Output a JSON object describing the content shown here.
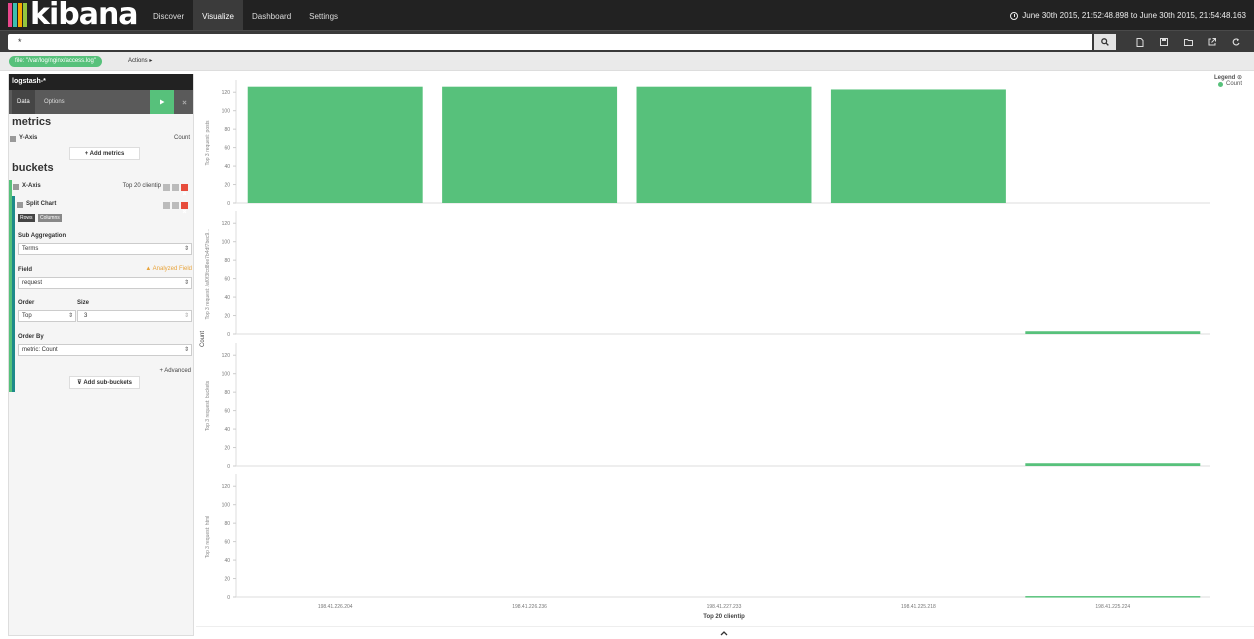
{
  "app": {
    "logo_text": "kibana",
    "logo_colors": [
      "#e8478b",
      "#3ebeb0",
      "#f5a700",
      "#94c63d"
    ],
    "nav": [
      "Discover",
      "Visualize",
      "Dashboard",
      "Settings"
    ],
    "active_nav": "Visualize",
    "time_range": "June 30th 2015, 21:52:48.898 to June 30th 2015, 21:54:48.163"
  },
  "search": {
    "query": "*",
    "toolbar_icons": [
      "new-icon",
      "save-icon",
      "open-icon",
      "share-icon",
      "refresh-icon"
    ]
  },
  "filter": {
    "pill": "file: \"/var/log/nginx/access.log\"",
    "actions": "Actions ▸"
  },
  "sidebar": {
    "index_pattern": "logstash-*",
    "tabs": [
      "Data",
      "Options"
    ],
    "metrics_heading": "metrics",
    "yaxis_label": "Y-Axis",
    "yaxis_value": "Count",
    "add_metrics": "+ Add metrics",
    "buckets_heading": "buckets",
    "xaxis_label": "X-Axis",
    "xaxis_value": "Top 20 clientip",
    "split_label": "Split Chart",
    "rows_label": "Rows",
    "columns_label": "Columns",
    "sub_agg_label": "Sub Aggregation",
    "sub_agg_value": "Terms",
    "field_label": "Field",
    "analyzed_warning": "Analyzed Field",
    "field_value": "request",
    "order_label": "Order",
    "size_label": "Size",
    "order_value": "Top",
    "size_value": "3",
    "order_by_label": "Order By",
    "order_by_value": "metric: Count",
    "advanced": "+ Advanced",
    "add_sub_buckets": "Add sub-buckets",
    "accent_green": "#57c17b",
    "accent_teal": "#1e8a8a"
  },
  "chart": {
    "legend_title": "Legend",
    "legend_item": "Count",
    "ylabel": "Count",
    "xlabel": "Top 20 clientip",
    "bar_color": "#57c17b"
  },
  "chart_data": {
    "type": "bar",
    "categories": [
      "198.41.226.204",
      "198.41.226.236",
      "198.41.227.233",
      "198.41.225.218",
      "198.41.225.224"
    ],
    "xlabel": "Top 20 clientip",
    "ylabel": "Count",
    "ylim": [
      0,
      130
    ],
    "yticks": [
      0,
      20,
      40,
      60,
      80,
      100,
      120
    ],
    "rows": [
      {
        "name": "Top 3 request: posts",
        "values": [
          126,
          126,
          126,
          123,
          0
        ]
      },
      {
        "name": "Top 3 request: /af0f3fcd8ee7b4df7bec9...",
        "values": [
          0,
          0,
          0,
          0,
          3
        ]
      },
      {
        "name": "Top 3 request: buckets",
        "values": [
          0,
          0,
          0,
          0,
          3
        ]
      },
      {
        "name": "Top 3 request: html",
        "values": [
          0,
          0,
          0,
          0,
          1
        ]
      }
    ]
  }
}
